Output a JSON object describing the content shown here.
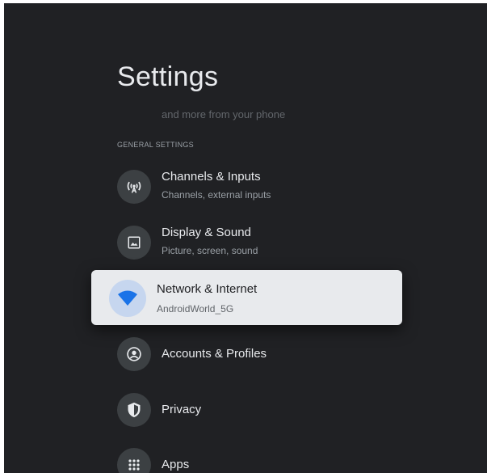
{
  "header": {
    "title": "Settings"
  },
  "faded_text": "and more from your phone",
  "section": {
    "label": "GENERAL SETTINGS"
  },
  "items": [
    {
      "label": "Channels & Inputs",
      "subtitle": "Channels, external inputs",
      "icon": "antenna-icon"
    },
    {
      "label": "Display & Sound",
      "subtitle": "Picture, screen, sound",
      "icon": "image-icon"
    },
    {
      "label": "Network & Internet",
      "subtitle": "AndroidWorld_5G",
      "icon": "wifi-icon",
      "focused": true
    },
    {
      "label": "Accounts & Profiles",
      "icon": "account-icon"
    },
    {
      "label": "Privacy",
      "icon": "shield-icon"
    },
    {
      "label": "Apps",
      "icon": "apps-grid-icon"
    }
  ],
  "colors": {
    "background": "#202124",
    "focused_card": "#e8eaed",
    "icon_circle": "#3c4043",
    "focused_icon_circle": "#c6d6ef",
    "wifi_icon": "#1a73e8"
  }
}
